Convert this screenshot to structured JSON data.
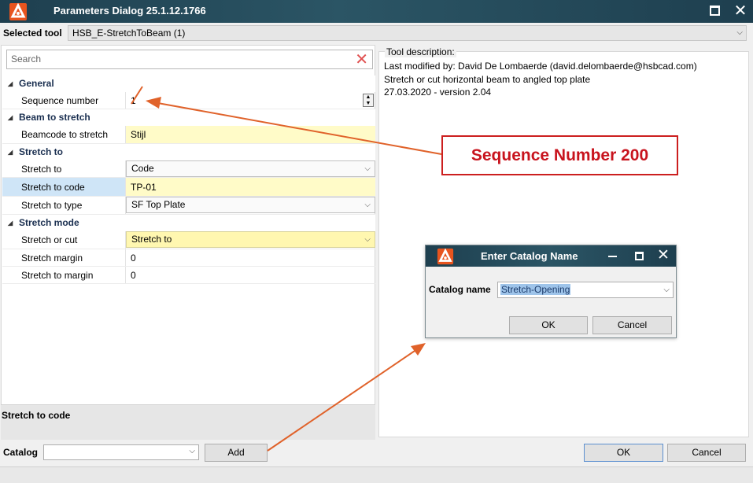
{
  "window": {
    "title": "Parameters Dialog 25.1.12.1766",
    "close_glyph": "✕"
  },
  "selected_tool": {
    "label": "Selected tool",
    "value": "HSB_E-StretchToBeam (1)"
  },
  "search": {
    "placeholder": "Search"
  },
  "grid": {
    "general": {
      "title": "General",
      "sequence_number": {
        "label": "Sequence number",
        "value": "1"
      }
    },
    "beam_to_stretch": {
      "title": "Beam to stretch",
      "beamcode": {
        "label": "Beamcode to stretch",
        "value": "Stijl"
      }
    },
    "stretch_to": {
      "title": "Stretch to",
      "stretch_to": {
        "label": "Stretch to",
        "value": "Code"
      },
      "stretch_to_code": {
        "label": "Stretch to code",
        "value": "TP-01"
      },
      "stretch_to_type": {
        "label": "Stretch to type",
        "value": "SF Top Plate"
      }
    },
    "stretch_mode": {
      "title": "Stretch mode",
      "stretch_or_cut": {
        "label": "Stretch or cut",
        "value": "Stretch to"
      },
      "stretch_margin": {
        "label": "Stretch margin",
        "value": "0"
      },
      "stretch_to_margin": {
        "label": "Stretch to margin",
        "value": "0"
      }
    }
  },
  "property_description": {
    "title": "Stretch to code"
  },
  "tool_description": {
    "header": "Tool description:",
    "lines": [
      "Last modified by: David De Lombaerde (david.delombaerde@hsbcad.com)",
      "Stretch or cut horizontal beam to angled top plate",
      "27.03.2020  -  version 2.04"
    ]
  },
  "bottom": {
    "catalog_label": "Catalog",
    "catalog_value": "",
    "add_label": "Add",
    "ok_label": "OK",
    "cancel_label": "Cancel"
  },
  "annotation": {
    "callout_text": "Sequence Number 200",
    "arrow_color": "#e0622a",
    "callout_color": "#c8141e"
  },
  "catalog_dialog": {
    "title": "Enter Catalog Name",
    "close_glyph": "✕",
    "catalog_label": "Catalog name",
    "catalog_value": "Stretch-Opening",
    "ok_label": "OK",
    "cancel_label": "Cancel"
  },
  "icons": {
    "app": "hsbcad-logo-icon",
    "dropdown": "chevron-down-icon",
    "clear": "clear-icon",
    "expand": "triangle-expanded-icon"
  },
  "colors": {
    "titlebar": "#2b5565",
    "selected_row": "#cfe5f7",
    "edited_value": "#fffbc8",
    "logo": "#e8541e"
  }
}
